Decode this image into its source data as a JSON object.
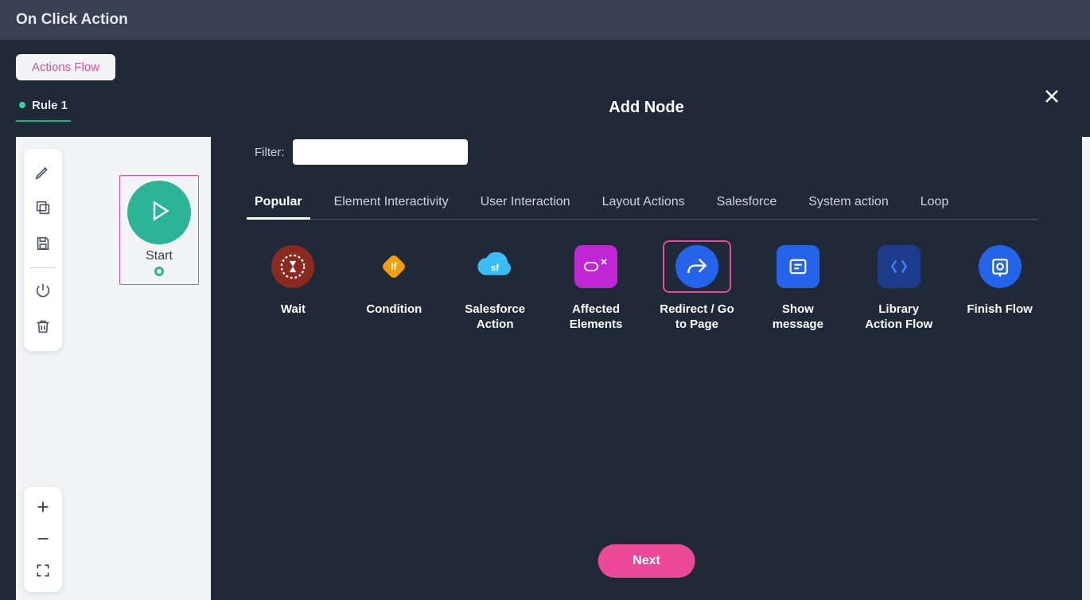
{
  "header": {
    "title": "On Click Action"
  },
  "sub_header": {
    "actions_flow_label": "Actions Flow"
  },
  "rule_tab": {
    "label": "Rule 1"
  },
  "canvas": {
    "start_label": "Start"
  },
  "modal": {
    "title": "Add Node",
    "filter_label": "Filter:",
    "filter_value": "",
    "tabs": [
      {
        "label": "Popular",
        "active": true
      },
      {
        "label": "Element Interactivity",
        "active": false
      },
      {
        "label": "User Interaction",
        "active": false
      },
      {
        "label": "Layout Actions",
        "active": false
      },
      {
        "label": "Salesforce",
        "active": false
      },
      {
        "label": "System action",
        "active": false
      },
      {
        "label": "Loop",
        "active": false
      }
    ],
    "nodes": [
      {
        "id": "wait",
        "label": "Wait",
        "color": "#8b2b1f",
        "icon": "hourglass"
      },
      {
        "id": "condition",
        "label": "Condition",
        "color": "#f59e0b",
        "icon": "diamond"
      },
      {
        "id": "salesforce",
        "label": "Salesforce Action",
        "color": "#38bdf8",
        "icon": "cloud"
      },
      {
        "id": "affected",
        "label": "Affected Elements",
        "color": "#c026d3",
        "icon": "hand-tap",
        "square": true
      },
      {
        "id": "redirect",
        "label": "Redirect / Go to Page",
        "color": "#2563eb",
        "icon": "arrow-share",
        "selected": true
      },
      {
        "id": "show-msg",
        "label": "Show message",
        "color": "#2563eb",
        "icon": "message",
        "square": true
      },
      {
        "id": "library",
        "label": "Library Action Flow",
        "color": "#1e3a8a",
        "icon": "flow",
        "square": true
      },
      {
        "id": "finish",
        "label": "Finish Flow",
        "color": "#2563eb",
        "icon": "finish"
      }
    ],
    "next_label": "Next"
  }
}
